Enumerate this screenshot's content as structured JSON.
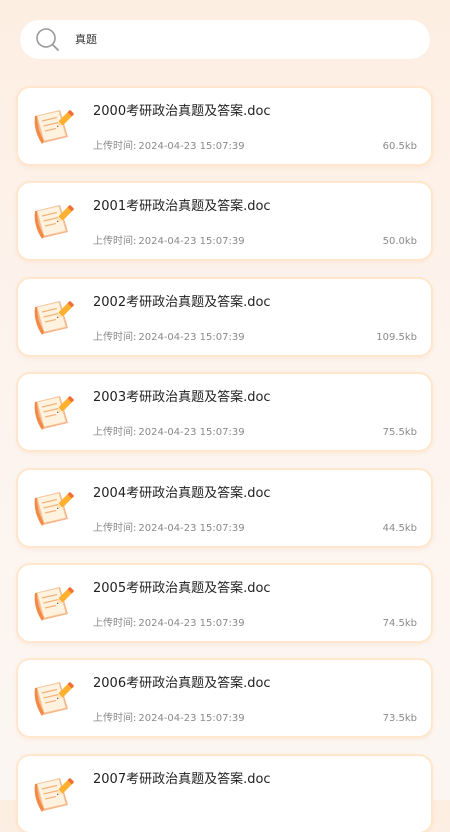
{
  "search": {
    "query": "真题"
  },
  "labels": {
    "upload_time": "上传时间:"
  },
  "icons": {
    "search": "search-icon",
    "document": "document-pencil-icon"
  },
  "colors": {
    "accent": "#f58a3c",
    "card_border": "#ffe6cc"
  },
  "files": [
    {
      "name": "2000考研政治真题及答案.doc",
      "time": "2024-04-23 15:07:39",
      "size": "60.5kb"
    },
    {
      "name": "2001考研政治真题及答案.doc",
      "time": "2024-04-23 15:07:39",
      "size": "50.0kb"
    },
    {
      "name": "2002考研政治真题及答案.doc",
      "time": "2024-04-23 15:07:39",
      "size": "109.5kb"
    },
    {
      "name": "2003考研政治真题及答案.doc",
      "time": "2024-04-23 15:07:39",
      "size": "75.5kb"
    },
    {
      "name": "2004考研政治真题及答案.doc",
      "time": "2024-04-23 15:07:39",
      "size": "44.5kb"
    },
    {
      "name": "2005考研政治真题及答案.doc",
      "time": "2024-04-23 15:07:39",
      "size": "74.5kb"
    },
    {
      "name": "2006考研政治真题及答案.doc",
      "time": "2024-04-23 15:07:39",
      "size": "73.5kb"
    },
    {
      "name": "2007考研政治真题及答案.doc",
      "time": "",
      "size": ""
    }
  ]
}
